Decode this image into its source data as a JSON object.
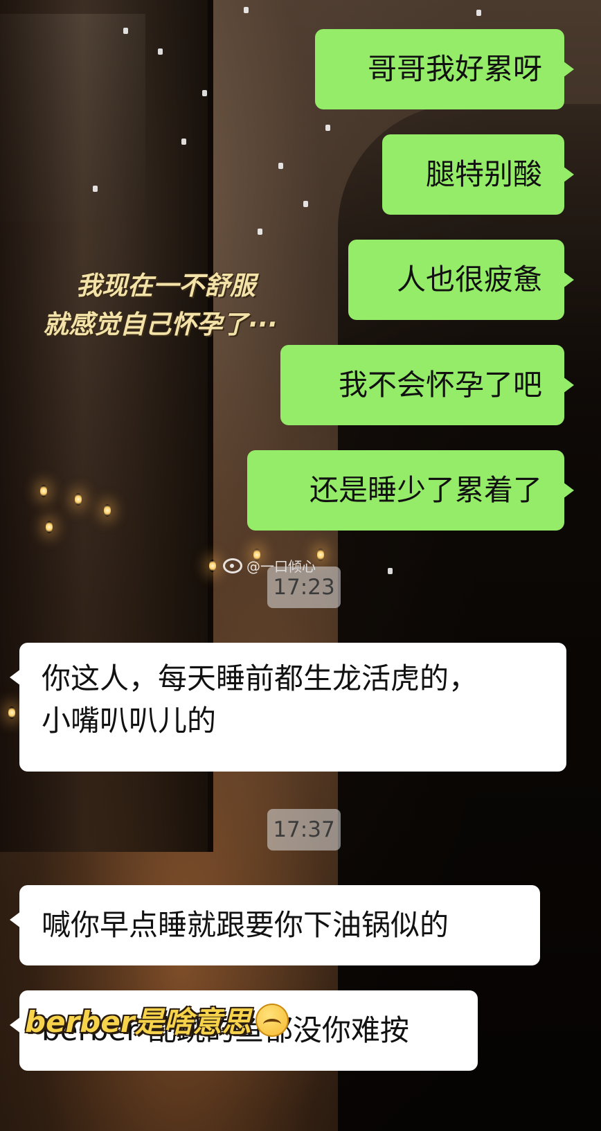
{
  "caption": {
    "line1": "我现在一不舒服",
    "line2": "就感觉自己怀孕了···"
  },
  "sent_messages": [
    "哥哥我好累呀",
    "腿特别酸",
    "人也很疲惫",
    "我不会怀孕了吧",
    "还是睡少了累着了"
  ],
  "watermark": "@一口倾心",
  "timestamps": [
    "17:23",
    "17:37"
  ],
  "received_messages": [
    {
      "line1": "你这人，每天睡前都生龙活虎的，",
      "line2": "小嘴叭叭儿的"
    },
    {
      "line1": "喊你早点睡就跟要你下油锅似的"
    },
    {
      "line1": "berber 乱跳的鱼都没你难按"
    }
  ],
  "overlay": {
    "text": "berber是啥意思",
    "emoji": "upside-down-face-emoji"
  },
  "colors": {
    "sent_bubble": "#95ec69",
    "received_bubble": "#ffffff",
    "caption": "#f4e3a8",
    "overlay": "#f6d34a"
  }
}
